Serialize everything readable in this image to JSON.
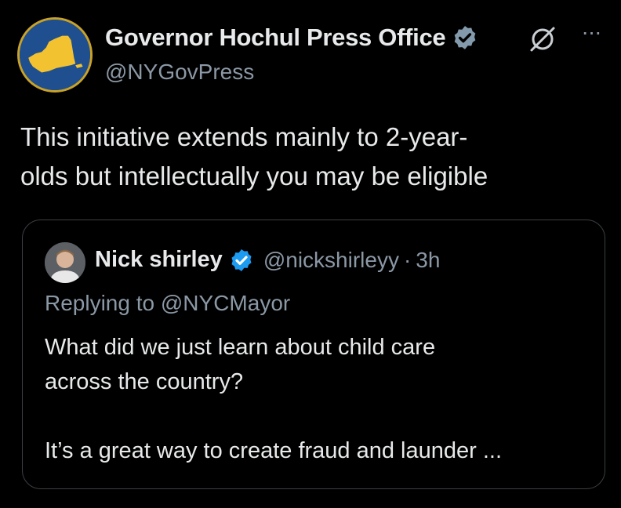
{
  "tweet": {
    "display_name": "Governor Hochul Press Office",
    "handle": "@NYGovPress",
    "verified_badge": "gray-government-badge",
    "text": "This initiative extends mainly to 2-year-olds but intellectually you may be eligible",
    "text_line1": "This initiative extends mainly to 2-year-",
    "text_line2": "olds but intellectually you may be eligible"
  },
  "icons": {
    "avatar": "new-york-state-logo",
    "grok": "grok-icon",
    "more": "more-options-icon",
    "more_glyph": "···"
  },
  "quote": {
    "display_name": "Nick shirley",
    "verified_badge": "blue-verified-badge",
    "handle": "@nickshirleyy",
    "separator": "·",
    "time": "3h",
    "replying_prefix": "Replying to",
    "replying_to": "@NYCMayor",
    "line1": "What did we just learn about child care",
    "line2": "across the country?",
    "line3": "It’s a great way to create fraud and launder ..."
  },
  "colors": {
    "background": "#000000",
    "text_primary": "#e7e9ea",
    "text_secondary": "#8b98a5",
    "blue_badge": "#1d9bf0",
    "gov_badge": "#829aab",
    "card_border": "#3a3f44"
  }
}
